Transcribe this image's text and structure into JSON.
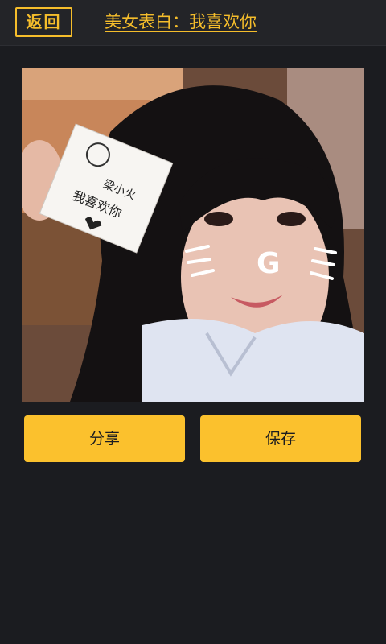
{
  "header": {
    "back_label": "返回",
    "title": "美女表白：我喜欢你"
  },
  "photo": {
    "card_text_line1": "梁小火",
    "card_text_line2": "我喜欢你",
    "face_doodle_letter": "G"
  },
  "actions": {
    "share_label": "分享",
    "save_label": "保存"
  },
  "colors": {
    "accent": "#fbc12d",
    "background": "#1b1c20",
    "topbar": "#232428"
  }
}
